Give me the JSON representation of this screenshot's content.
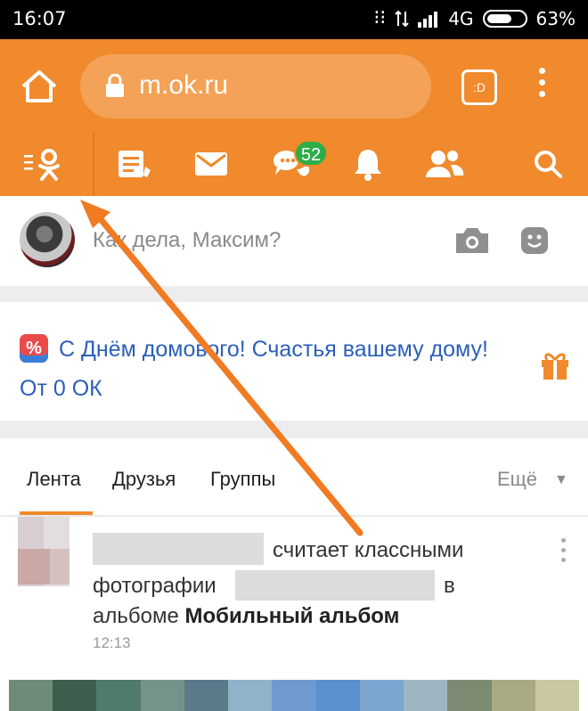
{
  "status_bar": {
    "time": "16:07",
    "network": "4G",
    "battery": "63%",
    "battery_level": 0.63,
    "icons": [
      "dots-icon",
      "data-arrows-icon",
      "signal-icon",
      "battery-icon"
    ]
  },
  "browser": {
    "url": "m.ok.ru",
    "tabs_label": ":D",
    "icons": [
      "home-icon",
      "lock-icon",
      "tabs-icon",
      "more-vert-icon"
    ]
  },
  "ok_nav": {
    "items": [
      "menu-logo",
      "notes-icon",
      "mail-icon",
      "messages-icon",
      "bell-icon",
      "friends-icon",
      "search-icon"
    ],
    "messages_badge": "52",
    "accent_color": "#f08a2c",
    "badge_color": "#2fae48"
  },
  "post_input": {
    "placeholder": "Как дела, Максим?",
    "icons": [
      "camera-icon",
      "smile-icon"
    ]
  },
  "promo": {
    "badge": "%",
    "text": "С Днём домового! Счастья вашему дому! От 0 ОК",
    "icon": "gift-icon",
    "link_color": "#2b5fb8"
  },
  "tabs": {
    "items": [
      "Лента",
      "Друзья",
      "Группы"
    ],
    "more": "Ещё",
    "active_index": 0
  },
  "feed": {
    "item": {
      "line1_suffix": "считает классными",
      "line2_prefix": "фотографии",
      "line2_suffix": "в",
      "line3_prefix": "альбоме",
      "album_name": "Мобильный альбом",
      "time": "12:13"
    }
  },
  "annotation": {
    "arrow_color": "#f07b22"
  }
}
